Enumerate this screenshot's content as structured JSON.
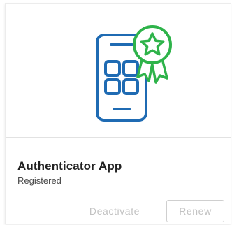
{
  "card": {
    "title": "Authenticator App",
    "status": "Registered",
    "icon": "authenticator-phone-award-icon",
    "actions": {
      "deactivate_label": "Deactivate",
      "renew_label": "Renew"
    }
  },
  "colors": {
    "phone_outline": "#1f6bb3",
    "badge_green": "#2eb34a",
    "button_disabled_text": "#c2c2c2"
  }
}
